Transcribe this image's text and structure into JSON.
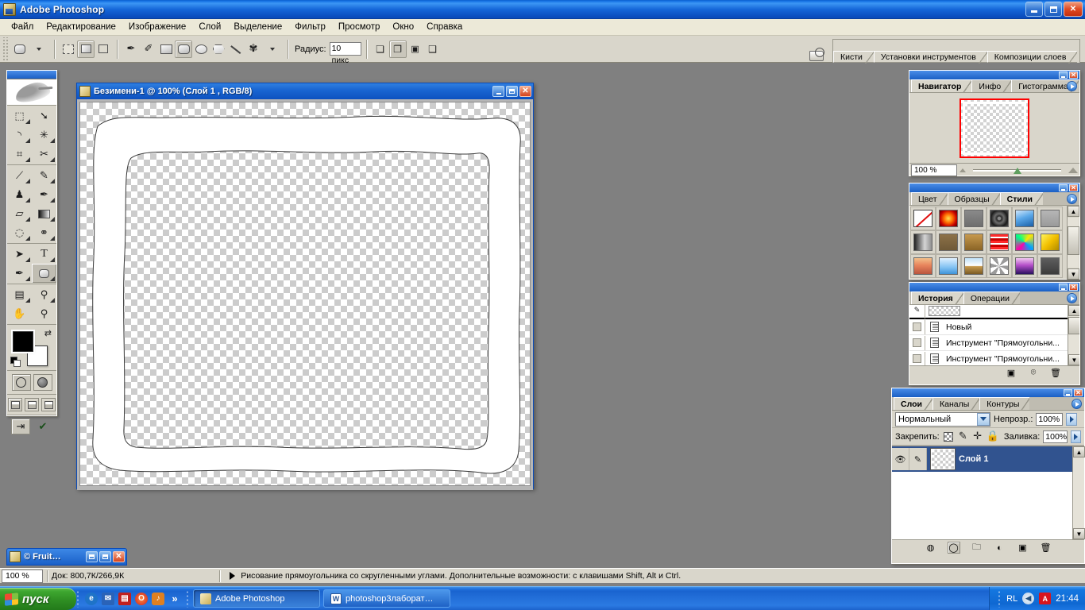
{
  "window": {
    "title": "Adobe Photoshop",
    "minimize_label": "—",
    "maximize_label": "❐",
    "close_label": "✕"
  },
  "menubar": {
    "items": [
      {
        "label": "Файл"
      },
      {
        "label": "Редактирование"
      },
      {
        "label": "Изображение"
      },
      {
        "label": "Слой"
      },
      {
        "label": "Выделение"
      },
      {
        "label": "Фильтр"
      },
      {
        "label": "Просмотр"
      },
      {
        "label": "Окно"
      },
      {
        "label": "Справка"
      }
    ]
  },
  "options_bar": {
    "radius_label": "Радиус:",
    "radius_value": "10 пикс",
    "tool_preset_name": "rounded-rectangle-tool",
    "mode_buttons": [
      "shape-layers-mode",
      "paths-mode",
      "fill-pixels-mode"
    ],
    "shape_tools": [
      "pen-tool",
      "freeform-pen-tool",
      "rectangle-tool",
      "rounded-rectangle-tool",
      "ellipse-tool",
      "polygon-tool",
      "line-tool",
      "custom-shape-tool"
    ],
    "boolean_buttons": [
      "add-to-shape",
      "subtract-from-shape",
      "intersect-shape",
      "exclude-overlapping"
    ],
    "palette_well": {
      "tabs": [
        {
          "label": "Кисти"
        },
        {
          "label": "Установки инструментов"
        },
        {
          "label": "Композиции слоев"
        }
      ]
    }
  },
  "toolbox": {
    "tools": [
      {
        "name": "marquee-tool",
        "glyph": "▭"
      },
      {
        "name": "move-tool",
        "glyph": "✥"
      },
      {
        "name": "lasso-tool",
        "glyph": "🖉"
      },
      {
        "name": "magic-wand-tool",
        "glyph": "✳"
      },
      {
        "name": "crop-tool",
        "glyph": "⌗"
      },
      {
        "name": "slice-tool",
        "glyph": "✂"
      },
      {
        "name": "healing-brush-tool",
        "glyph": "🩹"
      },
      {
        "name": "brush-tool",
        "glyph": "🖌"
      },
      {
        "name": "clone-stamp-tool",
        "glyph": "⎙"
      },
      {
        "name": "history-brush-tool",
        "glyph": "✎"
      },
      {
        "name": "eraser-tool",
        "glyph": "▱"
      },
      {
        "name": "gradient-tool",
        "glyph": "▤"
      },
      {
        "name": "blur-tool",
        "glyph": "💧"
      },
      {
        "name": "dodge-tool",
        "glyph": "🔍"
      },
      {
        "name": "path-selection-tool",
        "glyph": "➤"
      },
      {
        "name": "type-tool",
        "glyph": "T"
      },
      {
        "name": "pen-tool",
        "glyph": "✒"
      },
      {
        "name": "shape-tool",
        "glyph": "▢"
      },
      {
        "name": "notes-tool",
        "glyph": "🗒"
      },
      {
        "name": "eyedropper-tool",
        "glyph": "⚲"
      },
      {
        "name": "hand-tool",
        "glyph": "✋"
      },
      {
        "name": "zoom-tool",
        "glyph": "🔍"
      }
    ],
    "foreground_color": "#000000",
    "background_color": "#ffffff",
    "quick_mask": [
      "standard-mode",
      "quick-mask-mode"
    ],
    "screen_modes": [
      "standard-screen-mode",
      "full-screen-menubar",
      "full-screen"
    ],
    "jump_to": "jump-to-imageready"
  },
  "document": {
    "title": "Безимени-1 @ 100% (Слой 1 , RGB/8)",
    "zoom": "100%",
    "layer_name": "Слой 1",
    "color_mode": "RGB/8"
  },
  "navigator": {
    "tabs": [
      {
        "label": "Навигатор",
        "active": true
      },
      {
        "label": "Инфо",
        "active": false
      },
      {
        "label": "Гистограмма",
        "active": false
      }
    ],
    "zoom_value": "100 %"
  },
  "styles": {
    "tabs": [
      {
        "label": "Цвет",
        "active": false
      },
      {
        "label": "Образцы",
        "active": false
      },
      {
        "label": "Стили",
        "active": true
      }
    ],
    "swatches": [
      {
        "name": "none-style",
        "css": "#ffffff"
      },
      {
        "name": "red-glow-style",
        "css": "radial-gradient(circle at 50% 50%, #ffdf4f 0%, #ff6a00 38%, #c40000 70%, #5a0000 100%)"
      },
      {
        "name": "gray-button-style",
        "css": "linear-gradient(180deg,#8a8a8a,#6e6e6e)"
      },
      {
        "name": "dark-ring-style",
        "css": "radial-gradient(circle at 50% 50%, #8a8a8a 0 12%, #2a2a2a 20%, #6d6d6d 40%, #1c1c1c 70%, #505050 100%)"
      },
      {
        "name": "blue-sky-style",
        "css": "linear-gradient(160deg,#cfe6fb 0%,#5aa7e8 45%,#1b5fa8 100%)"
      },
      {
        "name": "flat-gray-style",
        "css": "linear-gradient(180deg,#b6b6b6,#9a9a9a)"
      },
      {
        "name": "metal-fade-style",
        "css": "linear-gradient(90deg,#1f1f1f,#d5d5d5 60%,#8f8f8f)"
      },
      {
        "name": "brown-style",
        "css": "linear-gradient(180deg,#8d7248,#6f5937)"
      },
      {
        "name": "gold-brown-style",
        "css": "linear-gradient(180deg,#c79a4e,#8a6426)"
      },
      {
        "name": "red-stripes-style",
        "css": "repeating-linear-gradient(180deg,#ff2b2b 0 3px,#ffffff 3px 5px,#c80000 5px 8px)"
      },
      {
        "name": "colorful-ribbon-style",
        "css": "conic-gradient(from 40deg,#ffe600,#00a2ff,#ff00a8,#00ff88,#ffe600)"
      },
      {
        "name": "yellow-bevel-style",
        "css": "linear-gradient(135deg,#fff45a 0%,#f2c000 50%,#b08a00 100%)"
      },
      {
        "name": "sunset-style",
        "css": "linear-gradient(180deg,#f3c08a,#e8845c 45%,#b9553f)"
      },
      {
        "name": "light-blue-style",
        "css": "linear-gradient(180deg,#dff0ff,#7fc0f2 60%,#3f93d8)"
      },
      {
        "name": "horizon-style",
        "css": "linear-gradient(180deg,#bfe0f7 0%,#ffffff 48%,#c79a4e 52%,#7a5a24 100%)"
      },
      {
        "name": "noise-style",
        "css": "repeating-conic-gradient(#ffffff 0 8%, #9a9a9a 0 16%)"
      },
      {
        "name": "purple-gradient-style",
        "css": "linear-gradient(180deg,#f0c8f0,#b44ec9 45%,#2a1060)"
      },
      {
        "name": "dark-gray-style",
        "css": "linear-gradient(180deg,#5e5e5e,#3c3c3c)"
      }
    ]
  },
  "history": {
    "tabs": [
      {
        "label": "История",
        "active": true
      },
      {
        "label": "Операции",
        "active": false
      }
    ],
    "items": [
      {
        "label": "Новый"
      },
      {
        "label": "Инструмент \"Прямоугольни..."
      },
      {
        "label": "Инструмент \"Прямоугольни..."
      }
    ],
    "footer_icons": [
      "new-document-from-state",
      "new-snapshot",
      "delete-state"
    ]
  },
  "layers": {
    "tabs": [
      {
        "label": "Слои",
        "active": true
      },
      {
        "label": "Каналы",
        "active": false
      },
      {
        "label": "Контуры",
        "active": false
      }
    ],
    "blend_mode": "Нормальный",
    "opacity_label": "Непрозр.:",
    "opacity_value": "100%",
    "lock_label": "Закрепить:",
    "fill_label": "Заливка:",
    "fill_value": "100%",
    "rows": [
      {
        "name": "Слой 1",
        "visible": true,
        "selected": true
      }
    ],
    "footer_icons": [
      "link-layers",
      "add-layer-style",
      "add-layer-mask",
      "new-adjustment-layer",
      "new-group",
      "new-layer",
      "delete-layer"
    ]
  },
  "minimized_document": {
    "title": "© Fruit…",
    "restore_label": "❐",
    "maximize_label": "▢",
    "close_label": "✕"
  },
  "status_bar": {
    "zoom": "100 %",
    "doc_info": "Док: 800,7К/266,9К",
    "message": "Рисование прямоугольника со скругленными углами. Дополнительные возможности: с клавишами Shift, Alt и Ctrl."
  },
  "taskbar": {
    "start_label": "пуск",
    "quick_launch": [
      {
        "name": "internet-explorer-icon",
        "glyph": "e",
        "color": "#1e73c8"
      },
      {
        "name": "outlook-icon",
        "glyph": "✉",
        "color": "#2a63b8"
      },
      {
        "name": "save-icon",
        "glyph": "▤",
        "color": "#c02020"
      },
      {
        "name": "opera-icon",
        "glyph": "O",
        "color": "#cc2020"
      },
      {
        "name": "media-icon",
        "glyph": "♪",
        "color": "#e08020"
      },
      {
        "name": "show-more-icon",
        "glyph": "»",
        "color": "#ffffff"
      }
    ],
    "tasks": [
      {
        "label": "Adobe Photoshop",
        "active": true,
        "icon": "photoshop-icon"
      },
      {
        "label": "photoshop3лаборат…",
        "active": false,
        "icon": "word-document-icon"
      }
    ],
    "tray": {
      "language": "RL",
      "icons": [
        {
          "name": "volume-icon",
          "glyph": "◀",
          "color": "#dfe9f5"
        },
        {
          "name": "antivirus-icon",
          "glyph": "A",
          "color": "#d7151d"
        }
      ],
      "clock": "21:44"
    }
  },
  "colors": {
    "titlebar_blue": "#1566d8",
    "panel_face": "#d9d6cb",
    "desktop_gray": "#808080",
    "selection_blue": "#31538f",
    "accent_red": "#ff0000"
  }
}
